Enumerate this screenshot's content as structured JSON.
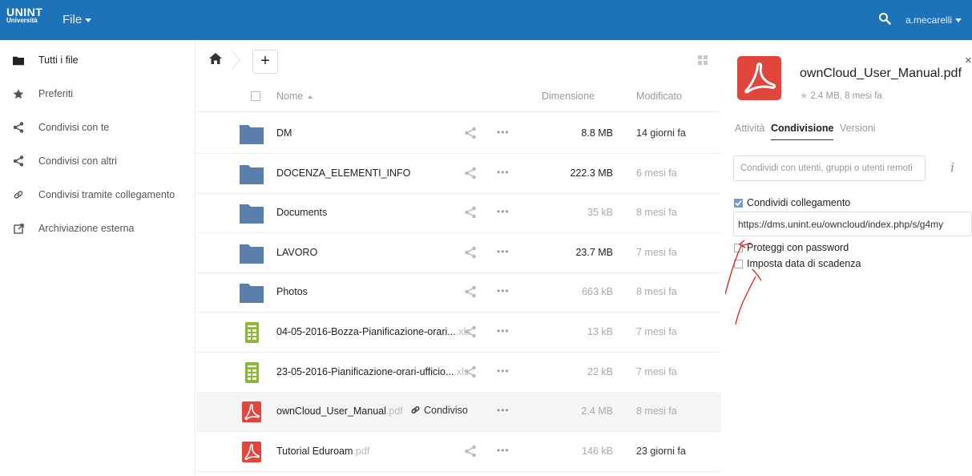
{
  "header": {
    "logo_line1": "UNINT",
    "logo_line2": "Università",
    "app_menu_label": "File",
    "user_label": "a.mecarelli",
    "accent_color": "#1d72b8"
  },
  "sidebar": {
    "items": [
      {
        "label": "Tutti i file",
        "icon": "folder-icon"
      },
      {
        "label": "Preferiti",
        "icon": "star-icon"
      },
      {
        "label": "Condivisi con te",
        "icon": "share-icon"
      },
      {
        "label": "Condivisi con altri",
        "icon": "share-icon"
      },
      {
        "label": "Condivisi tramite collegamento",
        "icon": "link-icon"
      },
      {
        "label": "Archiviazione esterna",
        "icon": "external-icon"
      }
    ]
  },
  "toolbar": {
    "add_label": "+"
  },
  "filelist": {
    "header": {
      "name": "Nome",
      "size": "Dimensione",
      "modified": "Modificato"
    },
    "rows": [
      {
        "name": "DM",
        "ext": "",
        "type": "folder",
        "size": "8.8 MB",
        "modified": "14 giorni fa"
      },
      {
        "name": "DOCENZA_ELEMENTI_INFO",
        "ext": "",
        "type": "folder",
        "size": "222.3 MB",
        "modified": "6 mesi fa"
      },
      {
        "name": "Documents",
        "ext": "",
        "type": "folder",
        "size": "35 kB",
        "modified": "8 mesi fa"
      },
      {
        "name": "LAVORO",
        "ext": "",
        "type": "folder",
        "size": "23.7 MB",
        "modified": "7 mesi fa"
      },
      {
        "name": "Photos",
        "ext": "",
        "type": "folder",
        "size": "663 kB",
        "modified": "8 mesi fa"
      },
      {
        "name": "04-05-2016-Bozza-Pianificazione-orari...",
        "ext": ".xls",
        "type": "spreadsheet",
        "size": "13 kB",
        "modified": "7 mesi fa"
      },
      {
        "name": "23-05-2016-Pianificazione-orari-ufficio...",
        "ext": ".xls",
        "type": "spreadsheet",
        "size": "22 kB",
        "modified": "7 mesi fa"
      },
      {
        "name": "ownCloud_User_Manual",
        "ext": ".pdf",
        "type": "pdf",
        "size": "2.4 MB",
        "modified": "8 mesi fa",
        "shared_label": "Condiviso"
      },
      {
        "name": "Tutorial Eduroam",
        "ext": ".pdf",
        "type": "pdf",
        "size": "146 kB",
        "modified": "23 giorni fa"
      }
    ]
  },
  "details": {
    "file_name": "ownCloud_User_Manual.pdf",
    "meta": "2.4 MB, 8 mesi fa",
    "tabs": [
      "Attività",
      "Condivisione",
      "Versioni"
    ],
    "active_tab": "Condivisione",
    "share_placeholder": "Condividi con utenti, gruppi o utenti remoti",
    "share_link_label": "Condividi collegamento",
    "share_link_value": "https://dms.unint.eu/owncloud/index.php/s/g4my",
    "password_label": "Proteggi con password",
    "expiry_label": "Imposta data di scadenza",
    "close_label": "×"
  },
  "colors": {
    "folder": "#5b7fad",
    "spreadsheet": "#8bb53f",
    "pdf": "#e0463b",
    "annotation": "#e02020"
  }
}
